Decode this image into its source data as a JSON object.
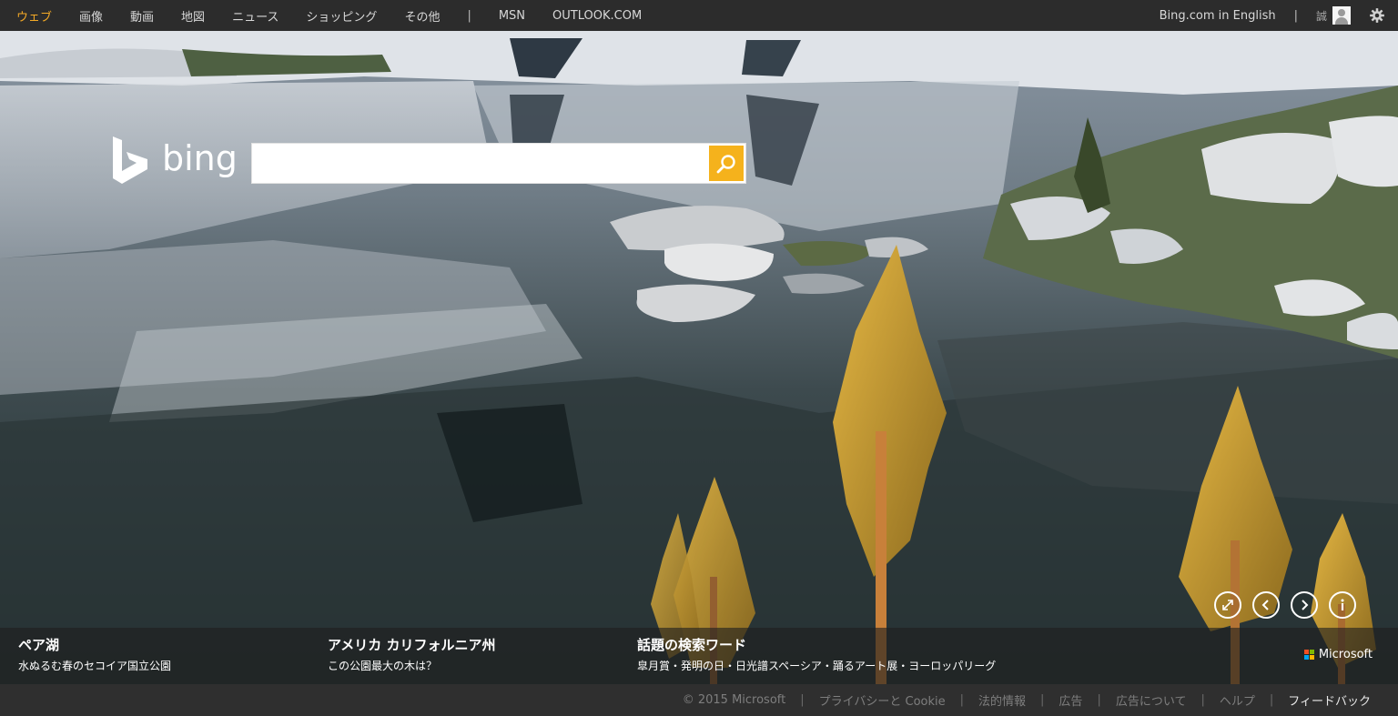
{
  "nav": {
    "left_items": [
      "ウェブ",
      "画像",
      "動画",
      "地図",
      "ニュース",
      "ショッピング",
      "その他"
    ],
    "separator": "|",
    "right_links": [
      "MSN",
      "OUTLOOK.COM"
    ],
    "english_link": "Bing.com in English",
    "user_name": "誠",
    "active_color": "#f3a926",
    "icons": [
      "user-avatar-icon",
      "gear-icon"
    ]
  },
  "logo": {
    "text": "bing"
  },
  "search": {
    "value": "",
    "placeholder": "",
    "button_icon": "search-icon",
    "button_color": "#f5b21c"
  },
  "controls": [
    "fullscreen-icon",
    "previous-image-icon",
    "next-image-icon",
    "info-icon"
  ],
  "strip": {
    "col1": {
      "title": "ペア湖",
      "subtitle": "水ぬるむ春のセコイア国立公園"
    },
    "col2": {
      "title": "アメリカ カリフォルニア州",
      "subtitle": "この公園最大の木は？"
    },
    "col3": {
      "title": "話題の検索ワード",
      "subtitle": "皐月賞・発明の日・日光譜スペーシア・踊るアート展・ヨーロッパリーグ"
    },
    "brand": "Microsoft"
  },
  "footer": {
    "copyright": "© 2015 Microsoft",
    "links": [
      "プライバシーと Cookie",
      "法的情報",
      "広告",
      "広告について",
      "ヘルプ"
    ],
    "feedback": "フィードバック",
    "separator": "|"
  }
}
